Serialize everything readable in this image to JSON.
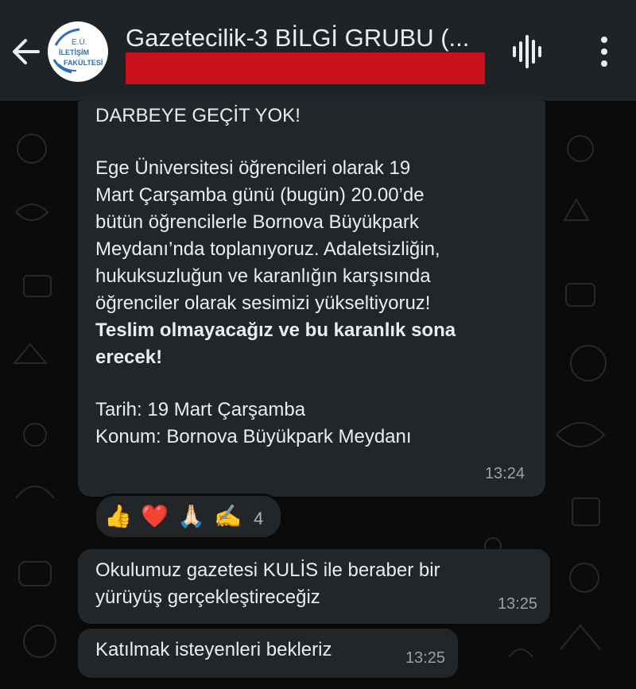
{
  "header": {
    "title": "Gazetecilik-3 BİLGİ GRUBU (...",
    "avatar_text": [
      "E.Ü.",
      "İLETİŞİM",
      "FAKÜLTESİ"
    ]
  },
  "messages": [
    {
      "lines": [
        "DARBEYE GEÇİT YOK!",
        "Ege Üniversitesi öğrencileri olarak 19",
        "Mart Çarşamba günü (bugün) 20.00’de",
        "bütün öğrencilerle Bornova Büyükpark",
        "Meydanı’nda toplanıyoruz. Adaletsizliğin,",
        "hukuksuzluğun ve karanlığın karşısında",
        "öğrenciler olarak sesimizi yükseltiyoruz!",
        "Teslim olmayacağız ve bu karanlık sona",
        "erecek!",
        "Tarih: 19 Mart Çarşamba",
        "Konum: Bornova Büyükpark Meydanı"
      ],
      "time": "13:24",
      "reactions": {
        "emojis": [
          "👍",
          "❤️",
          "🙏🏻",
          "✍️"
        ],
        "count": "4"
      }
    },
    {
      "lines": [
        "Okulumuz gazetesi KULİS ile beraber bir",
        "yürüyüş gerçekleştireceğiz"
      ],
      "time": "13:25"
    },
    {
      "lines": [
        "Katılmak isteyenleri bekleriz"
      ],
      "time": "13:25"
    }
  ],
  "colors": {
    "header_bg": "#1f2326",
    "chat_bg": "#0b0b0b",
    "bubble_bg": "#232628",
    "redaction": "#c8111c"
  },
  "icons": [
    "back-arrow-icon",
    "voice-call-icon",
    "more-vertical-icon"
  ]
}
